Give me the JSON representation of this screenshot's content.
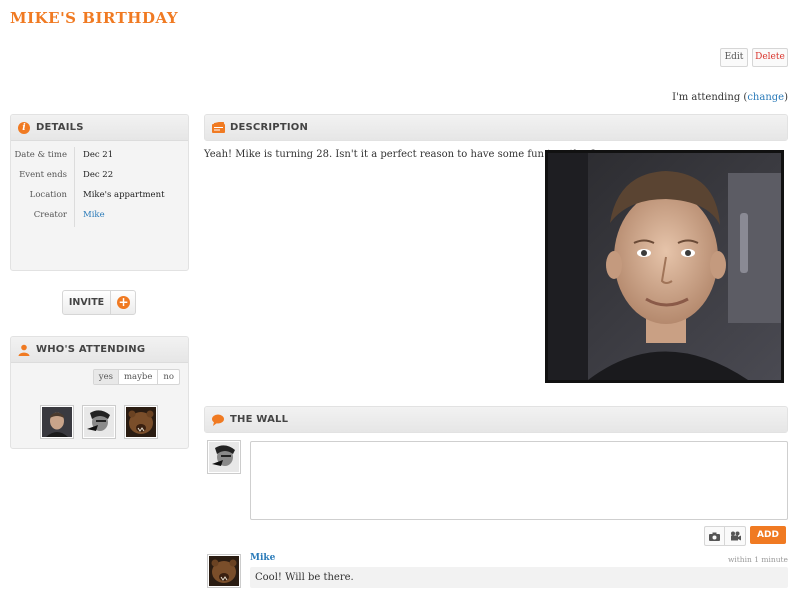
{
  "event": {
    "title": "MIKE'S BIRTHDAY",
    "edit_label": "Edit",
    "delete_label": "Delete",
    "attending_prefix": "I'm attending",
    "attending_open": "(",
    "attending_change": "change",
    "attending_close": ")"
  },
  "details": {
    "title": "DETAILS",
    "rows": [
      {
        "label": "Date & time",
        "value": "Dec 21"
      },
      {
        "label": "Event ends",
        "value": "Dec 22"
      },
      {
        "label": "Location",
        "value": "Mike's appartment"
      },
      {
        "label": "Creator",
        "value": "Mike"
      }
    ]
  },
  "invite": {
    "label": "INVITE",
    "plus": "+"
  },
  "attending": {
    "title": "WHO'S ATTENDING",
    "tabs": [
      "yes",
      "maybe",
      "no"
    ],
    "active_tab": "yes"
  },
  "description": {
    "title": "DESCRIPTION",
    "text": "Yeah! Mike is turning 28. Isn't it a perfect reason to have some fun together?"
  },
  "wall": {
    "title": "THE WALL",
    "textarea_value": "",
    "add_label": "ADD",
    "posts": [
      {
        "author": "Mike",
        "time": "within 1 minute",
        "text": "Cool! Will be there."
      }
    ]
  },
  "colors": {
    "accent": "#f07a22",
    "link": "#2b7bb9",
    "delete": "#d9332b"
  }
}
